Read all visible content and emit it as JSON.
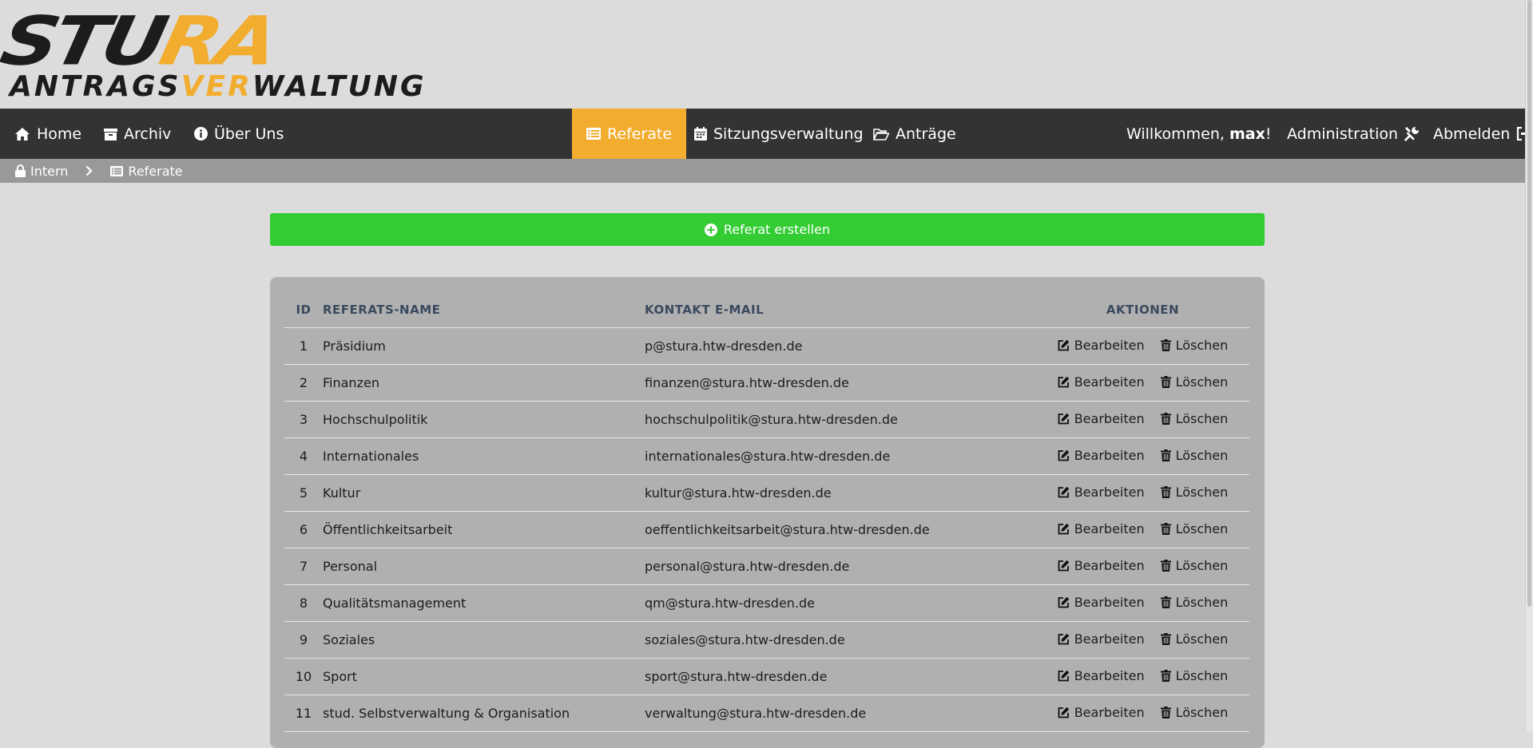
{
  "logo": {
    "top_part1": "STU",
    "top_part2": "RA",
    "bottom_part1": "ANTRAGS",
    "bottom_part2": "VER",
    "bottom_part3": "WALTUNG"
  },
  "nav": {
    "home": "Home",
    "archive": "Archiv",
    "about": "Über Uns",
    "departments": "Referate",
    "sessions": "Sitzungsverwaltung",
    "applications": "Anträge",
    "welcome_prefix": "Willkommen, ",
    "username": "max",
    "welcome_suffix": "!",
    "administration": "Administration",
    "logout": "Abmelden"
  },
  "breadcrumb": {
    "intern": "Intern",
    "current": "Referate"
  },
  "create_button": "Referat erstellen",
  "table": {
    "headers": {
      "id": "ID",
      "name": "REFERATS-NAME",
      "email": "KONTAKT E-MAIL",
      "actions": "AKTIONEN"
    },
    "edit_label": "Bearbeiten",
    "delete_label": "Löschen",
    "rows": [
      {
        "id": "1",
        "name": "Präsidium",
        "email": "p@stura.htw-dresden.de"
      },
      {
        "id": "2",
        "name": "Finanzen",
        "email": "finanzen@stura.htw-dresden.de"
      },
      {
        "id": "3",
        "name": "Hochschulpolitik",
        "email": "hochschulpolitik@stura.htw-dresden.de"
      },
      {
        "id": "4",
        "name": "Internationales",
        "email": "internationales@stura.htw-dresden.de"
      },
      {
        "id": "5",
        "name": "Kultur",
        "email": "kultur@stura.htw-dresden.de"
      },
      {
        "id": "6",
        "name": "Öffentlichkeitsarbeit",
        "email": "oeffentlichkeitsarbeit@stura.htw-dresden.de"
      },
      {
        "id": "7",
        "name": "Personal",
        "email": "personal@stura.htw-dresden.de"
      },
      {
        "id": "8",
        "name": "Qualitätsmanagement",
        "email": "qm@stura.htw-dresden.de"
      },
      {
        "id": "9",
        "name": "Soziales",
        "email": "soziales@stura.htw-dresden.de"
      },
      {
        "id": "10",
        "name": "Sport",
        "email": "sport@stura.htw-dresden.de"
      },
      {
        "id": "11",
        "name": "stud. Selbstverwaltung & Organisation",
        "email": "verwaltung@stura.htw-dresden.de"
      }
    ]
  },
  "colors": {
    "accent": "#f2ad2e",
    "navbar": "#333333",
    "create_button": "#33cc33",
    "breadcrumb": "#999999"
  }
}
